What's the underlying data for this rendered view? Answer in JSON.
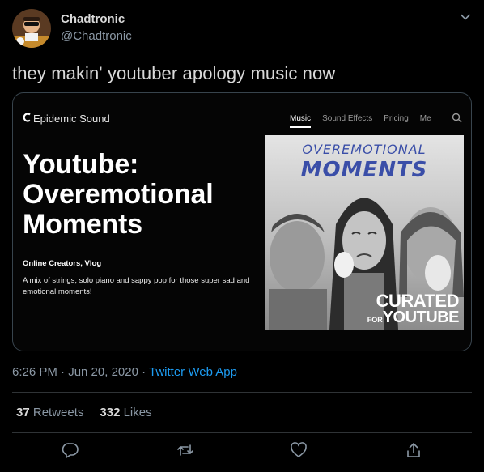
{
  "tweet": {
    "display_name": "Chadtronic",
    "handle": "@Chadtronic",
    "text": "they makin' youtuber apology music now",
    "time": "6:26 PM · Jun 20, 2020 · ",
    "app": "Twitter Web App",
    "retweets_count": "37",
    "retweets_label": "Retweets",
    "likes_count": "332",
    "likes_label": "Likes"
  },
  "card": {
    "brand": "Epidemic Sound",
    "nav": [
      "Music",
      "Sound Effects",
      "Pricing",
      "Me"
    ],
    "headline": [
      "Youtube:",
      "Overemotional",
      "Moments"
    ],
    "tags": "Online Creators, Vlog",
    "description": "A mix of strings, solo piano and sappy pop for those super sad and emotional moments!",
    "album": {
      "title_line1": "OVEREMOTIONAL",
      "title_line2": "MOMENTS",
      "badge_line1": "CURATED",
      "badge_line2_small": "FOR",
      "badge_line2": "YOUTUBE"
    }
  },
  "icons": [
    "chevron-down-icon",
    "search-icon",
    "reply-icon",
    "retweet-icon",
    "like-icon",
    "share-icon"
  ],
  "colors": {
    "link": "#1d9bf0",
    "muted": "#8b98a5",
    "album_title": "#3a4ea8"
  }
}
